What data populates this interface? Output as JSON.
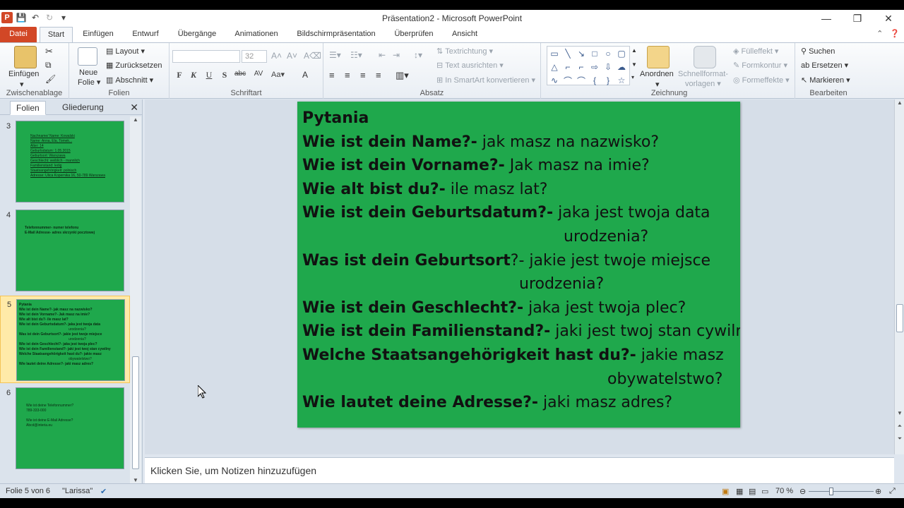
{
  "window": {
    "title": "Präsentation2  -  Microsoft PowerPoint",
    "controls": [
      "—",
      "❐",
      "✕"
    ]
  },
  "tabs": {
    "file": "Datei",
    "items": [
      "Start",
      "Einfügen",
      "Entwurf",
      "Übergänge",
      "Animationen",
      "Bildschirmpräsentation",
      "Überprüfen",
      "Ansicht"
    ],
    "active": "Start"
  },
  "ribbon": {
    "clipboard": {
      "label": "Zwischenablage",
      "paste": "Einfügen"
    },
    "slides": {
      "label": "Folien",
      "new_slide_1": "Neue",
      "new_slide_2": "Folie",
      "layout": "Layout",
      "reset": "Zurücksetzen",
      "section": "Abschnitt"
    },
    "font": {
      "label": "Schriftart",
      "size": "32"
    },
    "paragraph": {
      "label": "Absatz",
      "text_direction": "Textrichtung",
      "align_text": "Text ausrichten",
      "smartart": "In SmartArt konvertieren"
    },
    "drawing": {
      "label": "Zeichnung",
      "arrange": "Anordnen",
      "quick_styles_1": "Schnellformat-",
      "quick_styles_2": "vorlagen",
      "fill": "Fülleffekt",
      "outline": "Formkontur",
      "effects": "Formeffekte"
    },
    "editing": {
      "label": "Bearbeiten",
      "find": "Suchen",
      "replace": "Ersetzen",
      "select": "Markieren"
    }
  },
  "panel": {
    "tabs": [
      "Folien",
      "Gliederung"
    ],
    "thumbnails": [
      {
        "number": "3",
        "lines": [
          "Nachname/ Name: Kowalski",
          "Name: Anna, Ela, Tomek...",
          "Alter: 14",
          "Geburtsdatum: 1.05.2015",
          "Geburtsort: Warszawa",
          "Geschlecht: weiblich - mannlich",
          "Familienstand: ledig",
          "Staatsangehörigkeit: polnisch",
          "Adresse: Ulica Kopernika 16, 50-789 Warszawa"
        ]
      },
      {
        "number": "4",
        "lines": [
          "Telefonnummer- numer telefonu",
          "E-Mail Adresse- adres skrzynki pocztowej"
        ]
      },
      {
        "number": "5",
        "lines": [
          "Pytania",
          "Wie ist dein Name?- jak masz na nazwisko?",
          "Wie ist dein Vorname?- Jak masz na imie?",
          "Wie alt bist du?- ile masz lat?",
          "Wie ist dein Geburtsdatum?- jaka jest twoja data",
          "urodzenia?",
          "Was ist dein Geburtsort?- jakie jest twoje miejsce",
          "urodzenia?",
          "Wie ist dein Geschlecht?- jaka jest twoja plec?",
          "Wie ist dein Familienstand?- jaki jest twoj stan cywilny",
          "Welche Staatsangehörigkeit hast du?- jakie masz",
          "obywatelstwo?",
          "Wie lautet deine Adresse?- jaki masz adres?"
        ]
      },
      {
        "number": "6",
        "lines": [
          "Wie ist deine Telefonnummer?",
          "789-333-000",
          "",
          "Wie ist deine E-Mail Adresse?",
          "Abcd@interia.eu"
        ]
      }
    ]
  },
  "slide": {
    "lines": [
      {
        "bold": "Pytania",
        "rest": ""
      },
      {
        "bold": "Wie ist dein Name?-",
        "rest": " jak masz na nazwisko?"
      },
      {
        "bold": "Wie ist dein Vorname?-",
        "rest": " Jak masz na imie?"
      },
      {
        "bold": "Wie alt bist du?-",
        "rest": " ile masz lat?"
      },
      {
        "bold": "Wie ist dein Geburtsdatum?-",
        "rest": " jaka jest twoja data"
      },
      {
        "bold": "",
        "rest": "urodzenia?"
      },
      {
        "bold": "Was ist dein Geburtsort",
        "rest": "?- jakie jest twoje miejsce"
      },
      {
        "bold": "",
        "rest": "urodzenia?"
      },
      {
        "bold": "Wie ist dein Geschlecht?-",
        "rest": " jaka jest twoja plec?"
      },
      {
        "bold": "Wie ist dein Familienstand?-",
        "rest": " jaki jest twoj stan cywilny?"
      },
      {
        "bold": "Welche Staatsangehörigkeit hast du?-",
        "rest": " jakie masz"
      },
      {
        "bold": "",
        "rest": "obywatelstwo?"
      },
      {
        "bold": "Wie lautet deine Adresse?-",
        "rest": " jaki masz adres?"
      }
    ]
  },
  "notes": {
    "placeholder": "Klicken Sie, um Notizen hinzuzufügen"
  },
  "status": {
    "slide": "Folie 5 von 6",
    "theme": "\"Larissa\"",
    "zoom": "70 %"
  }
}
